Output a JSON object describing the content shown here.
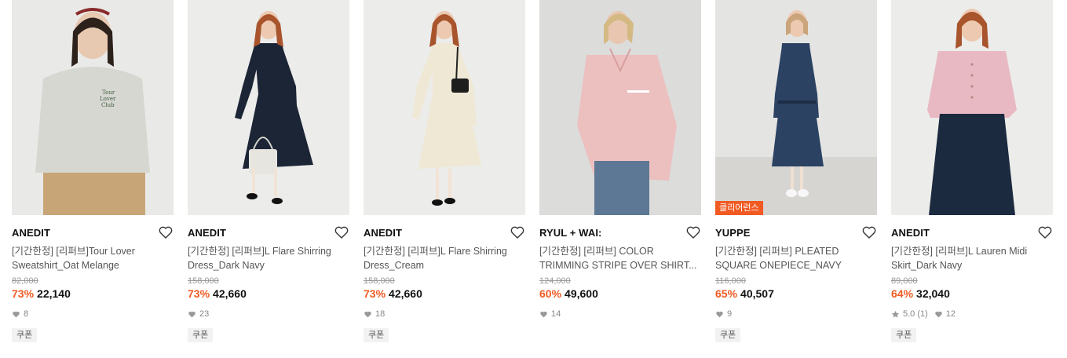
{
  "products": [
    {
      "brand": "ANEDIT",
      "name": "[기간한정] [리퍼브]Tour Lover Sweatshirt_Oat Melange",
      "original_price": "82,000",
      "discount": "73%",
      "price": "22,140",
      "likes": "8",
      "rating": null,
      "coupon": "쿠폰",
      "badge": null
    },
    {
      "brand": "ANEDIT",
      "name": "[기간한정] [리퍼브]L Flare Shirring Dress_Dark Navy",
      "original_price": "158,000",
      "discount": "73%",
      "price": "42,660",
      "likes": "23",
      "rating": null,
      "coupon": "쿠폰",
      "badge": null
    },
    {
      "brand": "ANEDIT",
      "name": "[기간한정] [리퍼브]L Flare Shirring Dress_Cream",
      "original_price": "158,000",
      "discount": "73%",
      "price": "42,660",
      "likes": "18",
      "rating": null,
      "coupon": "쿠폰",
      "badge": null
    },
    {
      "brand": "RYUL + WAI:",
      "name": "[기간한정] [리퍼브] COLOR TRIMMING STRIPE OVER SHIRT...",
      "original_price": "124,000",
      "discount": "60%",
      "price": "49,600",
      "likes": "14",
      "rating": null,
      "coupon": null,
      "badge": null
    },
    {
      "brand": "YUPPE",
      "name": "[기간한정] [리퍼브] PLEATED SQUARE ONEPIECE_NAVY",
      "original_price": "116,000",
      "discount": "65%",
      "price": "40,507",
      "likes": "9",
      "rating": null,
      "coupon": "쿠폰",
      "badge": "클리어런스"
    },
    {
      "brand": "ANEDIT",
      "name": "[기간한정] [리퍼브]L Lauren Midi Skirt_Dark Navy",
      "original_price": "89,000",
      "discount": "64%",
      "price": "32,040",
      "likes": "12",
      "rating": "5.0 (1)",
      "coupon": "쿠폰",
      "badge": null
    }
  ],
  "icons": {
    "wishlist": "heart-outline-icon",
    "likes": "heart-filled-icon",
    "rating": "star-icon"
  },
  "colors": {
    "discount": "#f15a22",
    "badge_bg": "#f15a22",
    "meta_gray": "#888888"
  }
}
